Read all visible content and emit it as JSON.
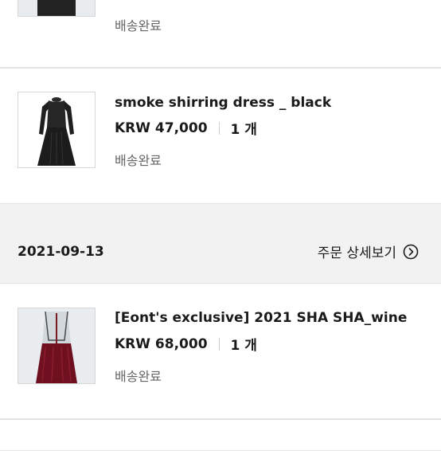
{
  "orders": [
    {
      "items": [
        {
          "name": "",
          "status": "배송완료",
          "thumbnail_icon": "tulle-dress-black-image"
        },
        {
          "name": "smoke shirring dress _ black",
          "price": "KRW 47,000",
          "quantity": "1 개",
          "status": "배송완료",
          "thumbnail_icon": "black-dress-image"
        }
      ]
    },
    {
      "date": "2021-09-13",
      "detail_link_label": "주문 상세보기",
      "detail_link_icon": "chevron-right-circle-icon",
      "items": [
        {
          "name": "[Eont's exclusive] 2021 SHA SHA_wine",
          "price": "KRW 68,000",
          "quantity": "1 개",
          "status": "배송완료",
          "thumbnail_icon": "wine-tulle-dress-image"
        }
      ]
    }
  ],
  "colors": {
    "background": "#f2f2f2",
    "card": "#ffffff",
    "text": "#1a1a1a",
    "muted": "#666666",
    "wine": "#6e1020"
  }
}
